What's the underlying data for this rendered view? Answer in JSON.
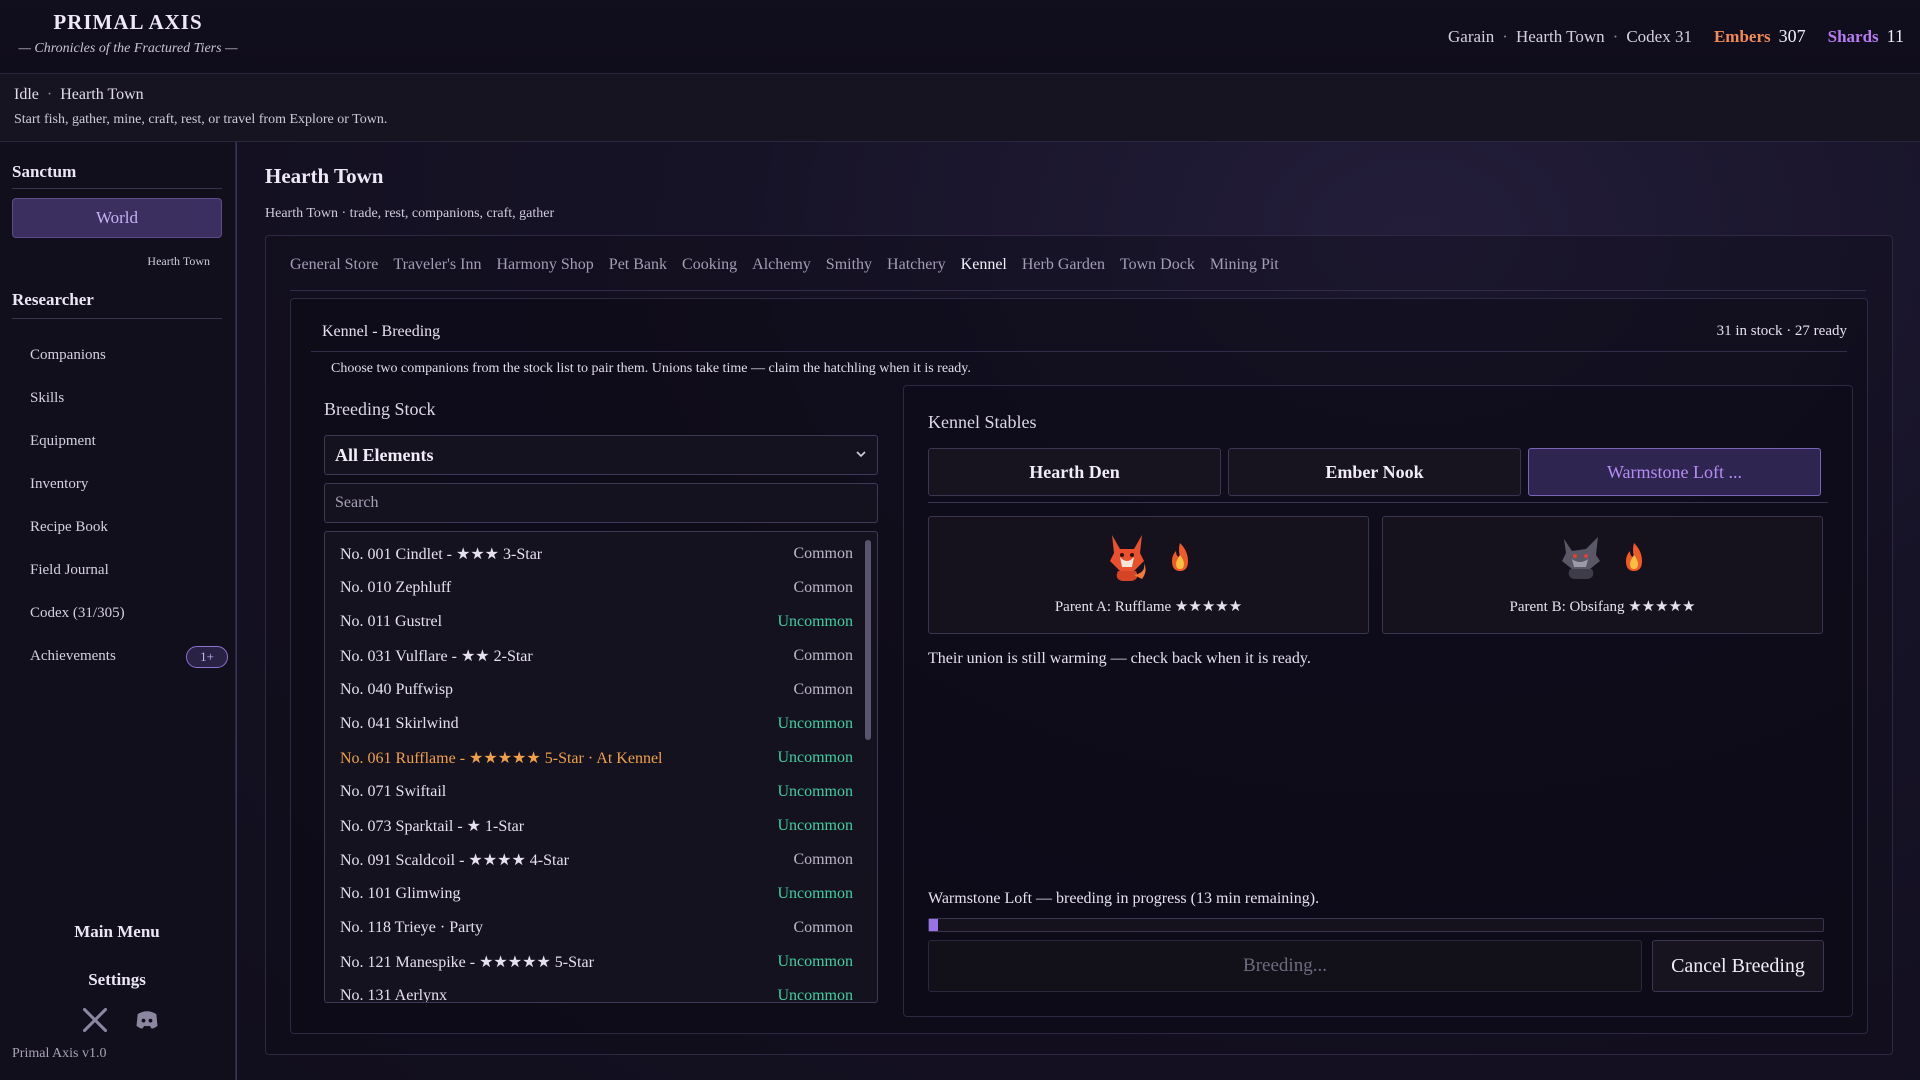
{
  "brand": {
    "title": "PRIMAL AXIS",
    "subtitle": "— Chronicles of the Fractured Tiers —"
  },
  "header": {
    "player": "Garain",
    "location": "Hearth Town",
    "codex": "Codex 31",
    "embers_label": "Embers",
    "embers_value": "307",
    "shards_label": "Shards",
    "shards_value": "11",
    "colors": {
      "embers": "#f08a57",
      "shards": "#b77cf0"
    }
  },
  "status": {
    "state": "Idle",
    "location": "Hearth Town",
    "hint": "Start fish, gather, mine, craft, rest, or travel from Explore or Town."
  },
  "sidebar": {
    "section1": "Sanctum",
    "world_button": "World",
    "world_sub": "Hearth Town",
    "section2": "Researcher",
    "items": [
      {
        "label": "Companions"
      },
      {
        "label": "Skills"
      },
      {
        "label": "Equipment"
      },
      {
        "label": "Inventory"
      },
      {
        "label": "Recipe Book"
      },
      {
        "label": "Field Journal"
      },
      {
        "label": "Codex (31/305)"
      },
      {
        "label": "Achievements",
        "badge": "1+"
      }
    ],
    "main_menu": "Main Menu",
    "settings": "Settings",
    "social_icons": [
      "x-icon",
      "discord-icon"
    ],
    "version": "Primal Axis  v1.0"
  },
  "main": {
    "title": "Hearth Town",
    "subtitle": "Hearth Town · trade, rest, companions, craft, gather",
    "tabs": [
      {
        "label": "General Store"
      },
      {
        "label": "Traveler's Inn"
      },
      {
        "label": "Harmony Shop"
      },
      {
        "label": "Pet Bank"
      },
      {
        "label": "Cooking"
      },
      {
        "label": "Alchemy"
      },
      {
        "label": "Smithy"
      },
      {
        "label": "Hatchery"
      },
      {
        "label": "Kennel",
        "active": true
      },
      {
        "label": "Herb Garden"
      },
      {
        "label": "Town Dock"
      },
      {
        "label": "Mining Pit"
      }
    ]
  },
  "kennel": {
    "heading": "Kennel - Breeding",
    "stock_summary": "31 in stock · 27 ready",
    "description": "Choose two companions from the stock list to pair them. Unions take time — claim the hatchling when it is ready.",
    "stock_title": "Breeding Stock",
    "filter_value": "All Elements",
    "search_placeholder": "Search",
    "rarity_colors": {
      "Common": "#bcb5c9",
      "Uncommon": "#3fcfa0"
    },
    "list": [
      {
        "name": "No. 001 Cindlet - ★★★ 3-Star",
        "rarity": "Common"
      },
      {
        "name": "No. 010 Zephluff",
        "rarity": "Common"
      },
      {
        "name": "No. 011 Gustrel",
        "rarity": "Uncommon"
      },
      {
        "name": "No. 031 Vulflare - ★★ 2-Star",
        "rarity": "Common"
      },
      {
        "name": "No. 040 Puffwisp",
        "rarity": "Common"
      },
      {
        "name": "No. 041 Skirlwind",
        "rarity": "Uncommon"
      },
      {
        "name": "No. 061 Rufflame - ★★★★★ 5-Star · At Kennel",
        "rarity": "Uncommon",
        "highlight": true
      },
      {
        "name": "No. 071 Swiftail",
        "rarity": "Uncommon"
      },
      {
        "name": "No. 073 Sparktail - ★ 1-Star",
        "rarity": "Uncommon"
      },
      {
        "name": "No. 091 Scaldcoil - ★★★★ 4-Star",
        "rarity": "Common"
      },
      {
        "name": "No. 101 Glimwing",
        "rarity": "Uncommon"
      },
      {
        "name": "No. 118 Trieye · Party",
        "rarity": "Common"
      },
      {
        "name": "No. 121 Manespike - ★★★★★ 5-Star",
        "rarity": "Uncommon"
      },
      {
        "name": "No. 131 Aerlynx",
        "rarity": "Uncommon"
      }
    ]
  },
  "stables": {
    "title": "Kennel Stables",
    "tabs": [
      {
        "label": "Hearth Den"
      },
      {
        "label": "Ember Nook"
      },
      {
        "label": "Warmstone Loft ...",
        "active": true
      }
    ],
    "parent_a": {
      "label": "Parent A: Rufflame ★★★★★",
      "icon": "fox-creature-icon",
      "element_icon": "fire-icon"
    },
    "parent_b": {
      "label": "Parent B: Obsifang ★★★★★",
      "icon": "wolf-creature-icon",
      "element_icon": "fire-icon"
    },
    "union_message": "Their union is still warming — check back when it is ready.",
    "progress_message": "Warmstone Loft — breeding in progress (13 min remaining).",
    "progress_fraction": 0.01,
    "breeding_button": "Breeding...",
    "cancel_button": "Cancel Breeding"
  }
}
